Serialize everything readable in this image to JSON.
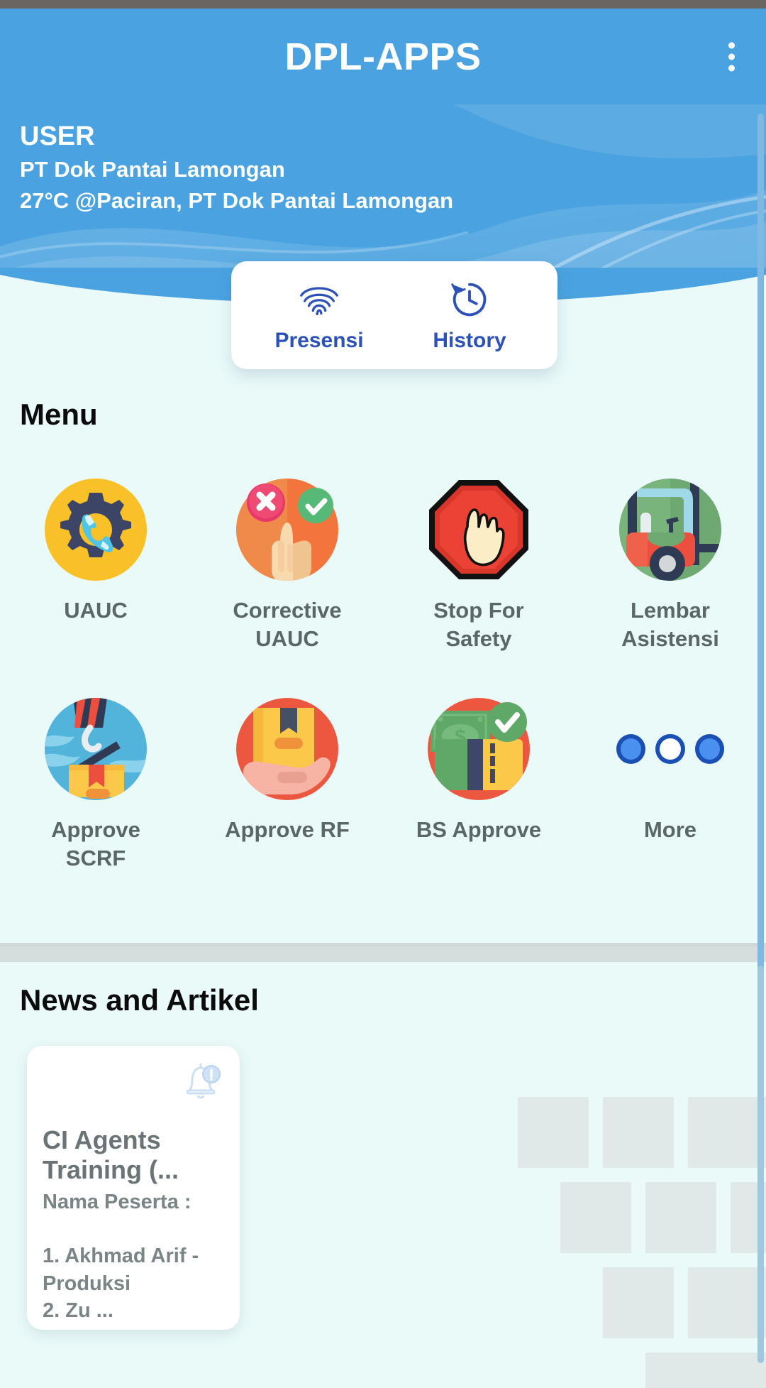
{
  "appbar": {
    "title": "DPL-APPS",
    "overflow_icon": "kebab-menu-icon"
  },
  "hero": {
    "user_label": "USER",
    "company": "PT Dok Pantai Lamongan",
    "weather_location": "27°C @Paciran, PT Dok Pantai Lamongan"
  },
  "presence_card": {
    "items": [
      {
        "label": "Presensi",
        "icon": "fingerprint-icon"
      },
      {
        "label": "History",
        "icon": "history-clock-icon"
      }
    ]
  },
  "menu": {
    "title": "Menu",
    "items": [
      {
        "label": "UAUC",
        "icon": "gear-phone-icon"
      },
      {
        "label": "Corrective UAUC",
        "icon": "hand-tap-check-cross-icon"
      },
      {
        "label": "Stop For Safety",
        "icon": "stop-hand-octagon-icon"
      },
      {
        "label": "Lembar Asistensi",
        "icon": "forklift-icon"
      },
      {
        "label": "Approve SCRF",
        "icon": "crane-hook-box-icon"
      },
      {
        "label": "Approve RF",
        "icon": "hand-holding-box-icon"
      },
      {
        "label": "BS Approve",
        "icon": "money-check-icon"
      },
      {
        "label": "More",
        "icon": "three-dots-icon"
      }
    ]
  },
  "news": {
    "title": "News and Artikel",
    "cards": [
      {
        "icon": "bell-alert-icon",
        "title": "CI Agents Training (...",
        "body": "Nama Peserta :\n\n1. Akhmad Arif - Produksi\n2. Zu ..."
      }
    ]
  },
  "colors": {
    "primary_blue": "#4aa3e0",
    "accent_blue": "#2c52b8",
    "page_bg": "#eafaf9",
    "label_gray": "#5b6668"
  }
}
